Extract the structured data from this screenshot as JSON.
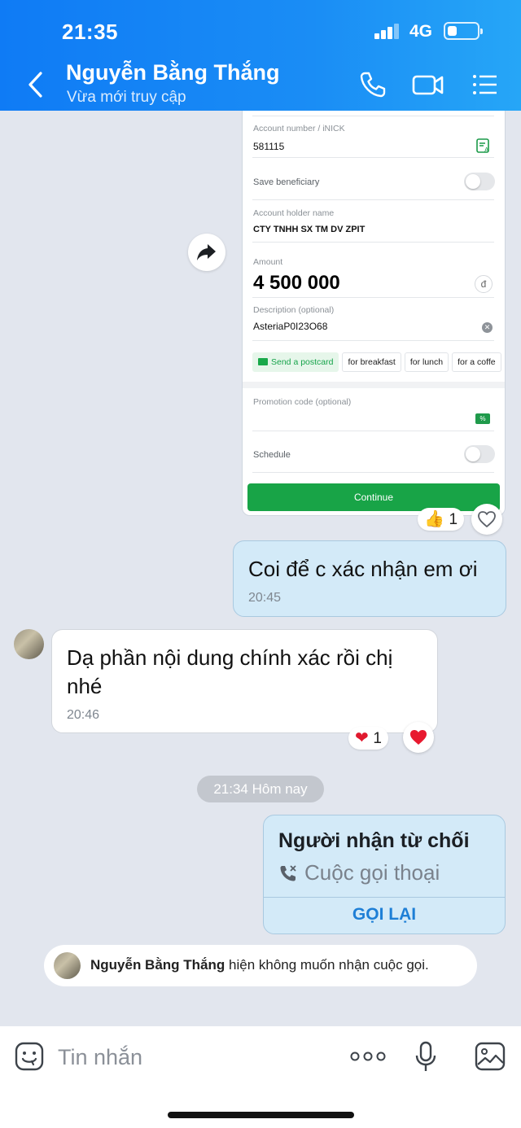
{
  "status_bar": {
    "time": "21:35",
    "network": "4G"
  },
  "header": {
    "contact_name": "Nguyễn Bằng Thắng",
    "contact_status": "Vừa mới truy cập"
  },
  "transfer_screenshot": {
    "account_label": "Account number / iNICK",
    "account_value": "581115",
    "save_label": "Save beneficiary",
    "holder_label": "Account holder name",
    "holder_value": "CTY TNHH SX TM DV ZPIT",
    "amount_label": "Amount",
    "amount_value": "4 500 000",
    "currency_symbol": "đ",
    "description_label": "Description (optional)",
    "description_value": "AsteriaP0I23O68",
    "chips": [
      "Send a postcard",
      "for breakfast",
      "for lunch",
      "for a coffe"
    ],
    "promo_label": "Promotion code (optional)",
    "promo_icon": "%",
    "schedule_label": "Schedule",
    "continue_label": "Continue"
  },
  "reactions": {
    "image": {
      "emoji": "👍",
      "count": "1"
    },
    "received": {
      "emoji": "❤",
      "count": "1"
    }
  },
  "messages": [
    {
      "text": "Coi để c xác nhận em ơi",
      "time": "20:45"
    },
    {
      "text": "Dạ phần nội dung chính xác rồi chị nhé",
      "time": "20:46"
    }
  ],
  "date_separator": "21:34 Hôm nay",
  "call_card": {
    "title": "Người nhận từ chối",
    "subtitle": "Cuộc gọi thoại",
    "action": "GỌI LẠI"
  },
  "system_notice": {
    "name": "Nguyễn Bằng Thắng",
    "text": " hiện không muốn nhận cuộc gọi."
  },
  "input": {
    "placeholder": "Tin nhắn"
  },
  "colors": {
    "header": "#1a8df5",
    "sent_bubble": "#d3eaf8",
    "accent": "#1e7fd6",
    "continue": "#18a447"
  }
}
